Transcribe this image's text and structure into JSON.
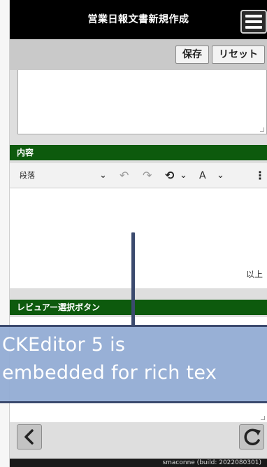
{
  "header": {
    "title": "営業日報文書新規作成",
    "menu_icon": "hamburger-menu-icon"
  },
  "toolbar": {
    "save_label": "保存",
    "reset_label": "リセット"
  },
  "sections": {
    "content_label": "内容",
    "reviewer_label": "レビュアー選択ボタン"
  },
  "editor": {
    "heading_select": "段落",
    "chevron": "⌄",
    "undo": "↶",
    "redo": "↷",
    "find_icon": "⟲",
    "font_icon": "A",
    "more_icon": "⋮",
    "closing_text": "以上"
  },
  "callout": {
    "line1": "CKEditor 5 is",
    "line2": "embedded for rich tex"
  },
  "footer": {
    "text": "smaconne (build: 2022080301)"
  },
  "colors": {
    "section_green": "#0d5a0d",
    "header_black": "#000000",
    "callout_fill": "#92acd4",
    "callout_border": "#3b4a6e"
  }
}
